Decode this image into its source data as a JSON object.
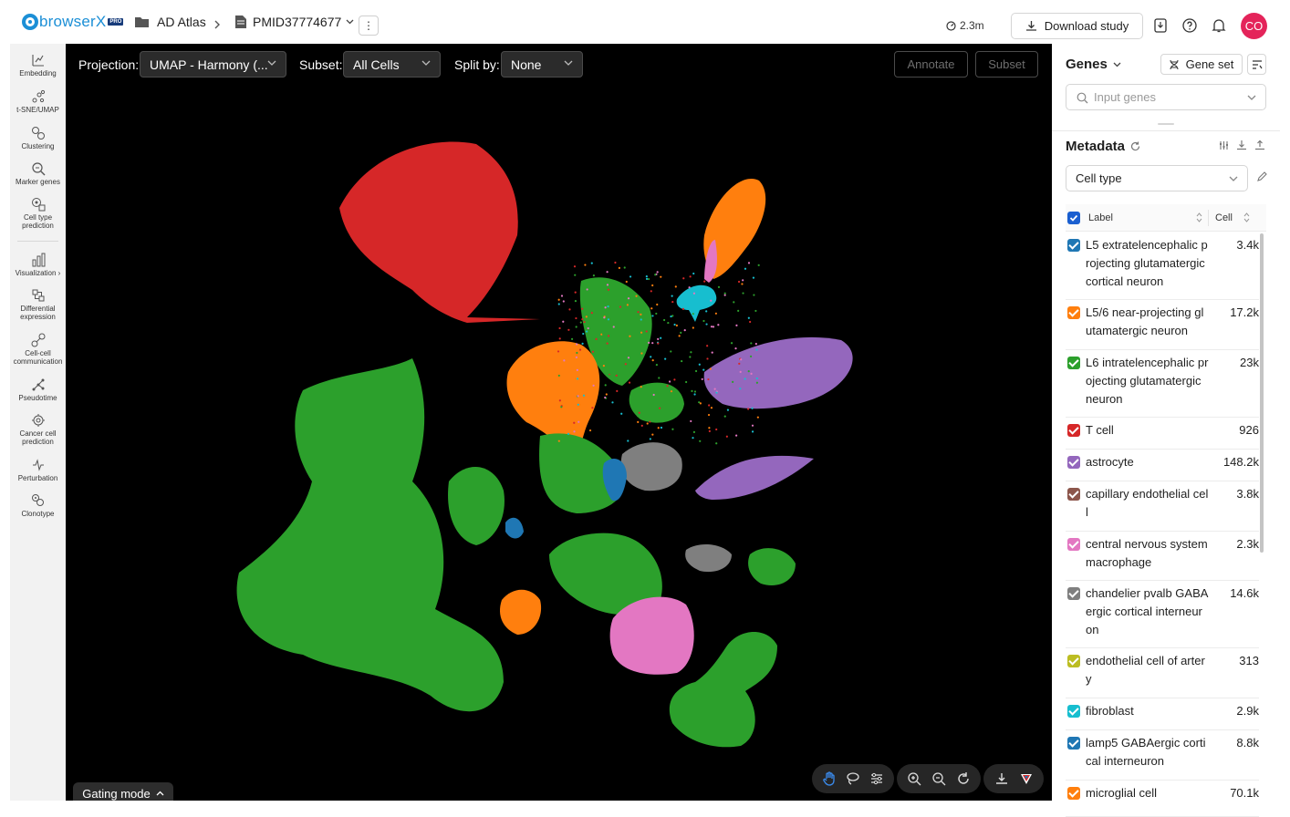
{
  "brand": {
    "name": "browserX",
    "badge": "PRO"
  },
  "breadcrumbs": [
    {
      "label": "AD Atlas"
    },
    {
      "label": "PMID37774677"
    }
  ],
  "header": {
    "metric": "2.3m",
    "download_label": "Download study",
    "avatar_initials": "CO"
  },
  "sidebar": {
    "items": [
      {
        "label": "Embedding",
        "icon": "embedding-icon"
      },
      {
        "label": "t-SNE/UMAP",
        "icon": "scatter-icon"
      },
      {
        "label": "Clustering",
        "icon": "clustering-icon"
      },
      {
        "label": "Marker genes",
        "icon": "magnifier-icon"
      },
      {
        "label": "Cell type prediction",
        "icon": "cell-predict-icon"
      },
      {
        "label": "Visualization ›",
        "icon": "bar-chart-icon"
      },
      {
        "label": "Differential expression",
        "icon": "diff-expression-icon"
      },
      {
        "label": "Cell-cell communication",
        "icon": "communication-icon"
      },
      {
        "label": "Pseudotime",
        "icon": "pseudotime-icon"
      },
      {
        "label": "Cancer cell prediction",
        "icon": "cancer-cell-icon"
      },
      {
        "label": "Perturbation",
        "icon": "perturbation-icon"
      },
      {
        "label": "Clonotype",
        "icon": "clonotype-icon"
      }
    ]
  },
  "canvas_controls": {
    "projection_label": "Projection:",
    "projection_value": "UMAP - Harmony (...",
    "subset_label": "Subset:",
    "subset_value": "All Cells",
    "split_label": "Split by:",
    "split_value": "None",
    "annotate_label": "Annotate",
    "subset_button_label": "Subset",
    "gating_label": "Gating mode"
  },
  "genes": {
    "title": "Genes",
    "gene_set_label": "Gene set",
    "input_placeholder": "Input genes"
  },
  "metadata": {
    "title": "Metadata",
    "selected_field": "Cell type",
    "col_label": "Label",
    "col_cell": "Cell",
    "rows": [
      {
        "label": "L5 extratelencephalic projecting glutamatergic cortical neuron",
        "count": "3.4k",
        "color": "#1f77b4"
      },
      {
        "label": "L5/6 near-projecting glutamatergic neuron",
        "count": "17.2k",
        "color": "#ff7f0e"
      },
      {
        "label": "L6 intratelencephalic projecting glutamatergic neuron",
        "count": "23k",
        "color": "#2ca02c"
      },
      {
        "label": "T cell",
        "count": "926",
        "color": "#d62728"
      },
      {
        "label": "astrocyte",
        "count": "148.2k",
        "color": "#9467bd"
      },
      {
        "label": "capillary endothelial cell",
        "count": "3.8k",
        "color": "#8c564b"
      },
      {
        "label": "central nervous system macrophage",
        "count": "2.3k",
        "color": "#e377c2"
      },
      {
        "label": "chandelier pvalb GABAergic cortical interneuron",
        "count": "14.6k",
        "color": "#7f7f7f"
      },
      {
        "label": "endothelial cell of artery",
        "count": "313",
        "color": "#bcbd22"
      },
      {
        "label": "fibroblast",
        "count": "2.9k",
        "color": "#17becf"
      },
      {
        "label": "lamp5 GABAergic cortical interneuron",
        "count": "8.8k",
        "color": "#1f77b4"
      },
      {
        "label": "microglial cell",
        "count": "70.1k",
        "color": "#ff7f0e"
      }
    ]
  }
}
